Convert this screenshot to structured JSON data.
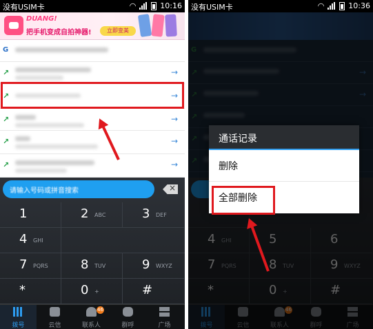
{
  "status_bar": {
    "left": {
      "carrier": "没有USIM卡",
      "time": "10:16"
    },
    "right": {
      "carrier": "没有USIM卡",
      "time": "10:36"
    }
  },
  "ad_banner": {
    "title": "DUANG!",
    "subtitle": "把手机变成自拍神器!",
    "button_label": "立即变美"
  },
  "call_log": {
    "rows": [
      {
        "type_icon": "G",
        "kind": "group",
        "arrow": "→"
      },
      {
        "type_icon": "↗",
        "kind": "outgoing",
        "arrow": "→"
      },
      {
        "type_icon": "↗",
        "kind": "outgoing",
        "arrow": "→",
        "highlighted": true
      },
      {
        "type_icon": "↗",
        "kind": "outgoing",
        "arrow": "→"
      },
      {
        "type_icon": "↗",
        "kind": "outgoing",
        "arrow": "→"
      },
      {
        "type_icon": "↗",
        "kind": "outgoing",
        "arrow": "→"
      }
    ]
  },
  "dialer": {
    "input_placeholder": "请输入号码或拼音搜索",
    "keys": [
      {
        "digit": "1",
        "letters": ""
      },
      {
        "digit": "2",
        "letters": "ABC"
      },
      {
        "digit": "3",
        "letters": "DEF"
      },
      {
        "digit": "4",
        "letters": "GHI"
      },
      {
        "digit": "5",
        "letters": "JKL"
      },
      {
        "digit": "6",
        "letters": "MNO"
      },
      {
        "digit": "7",
        "letters": "PQRS"
      },
      {
        "digit": "8",
        "letters": "TUV"
      },
      {
        "digit": "9",
        "letters": "WXYZ"
      },
      {
        "digit": "*",
        "letters": ""
      },
      {
        "digit": "0",
        "letters": "+"
      },
      {
        "digit": "#",
        "letters": ""
      }
    ]
  },
  "tabs": [
    {
      "label": "拨号",
      "icon": "dialpad-icon",
      "active": true
    },
    {
      "label": "云信",
      "icon": "chat-icon"
    },
    {
      "label": "联系人",
      "icon": "contacts-icon",
      "badge": "46"
    },
    {
      "label": "群呼",
      "icon": "group-call-icon"
    },
    {
      "label": "广场",
      "icon": "square-icon"
    }
  ],
  "dialog": {
    "title": "通话记录",
    "items": [
      "删除",
      "全部删除"
    ],
    "highlighted_item": "全部删除"
  },
  "colors": {
    "accent": "#2d9cf0",
    "highlight": "#e0191e"
  }
}
